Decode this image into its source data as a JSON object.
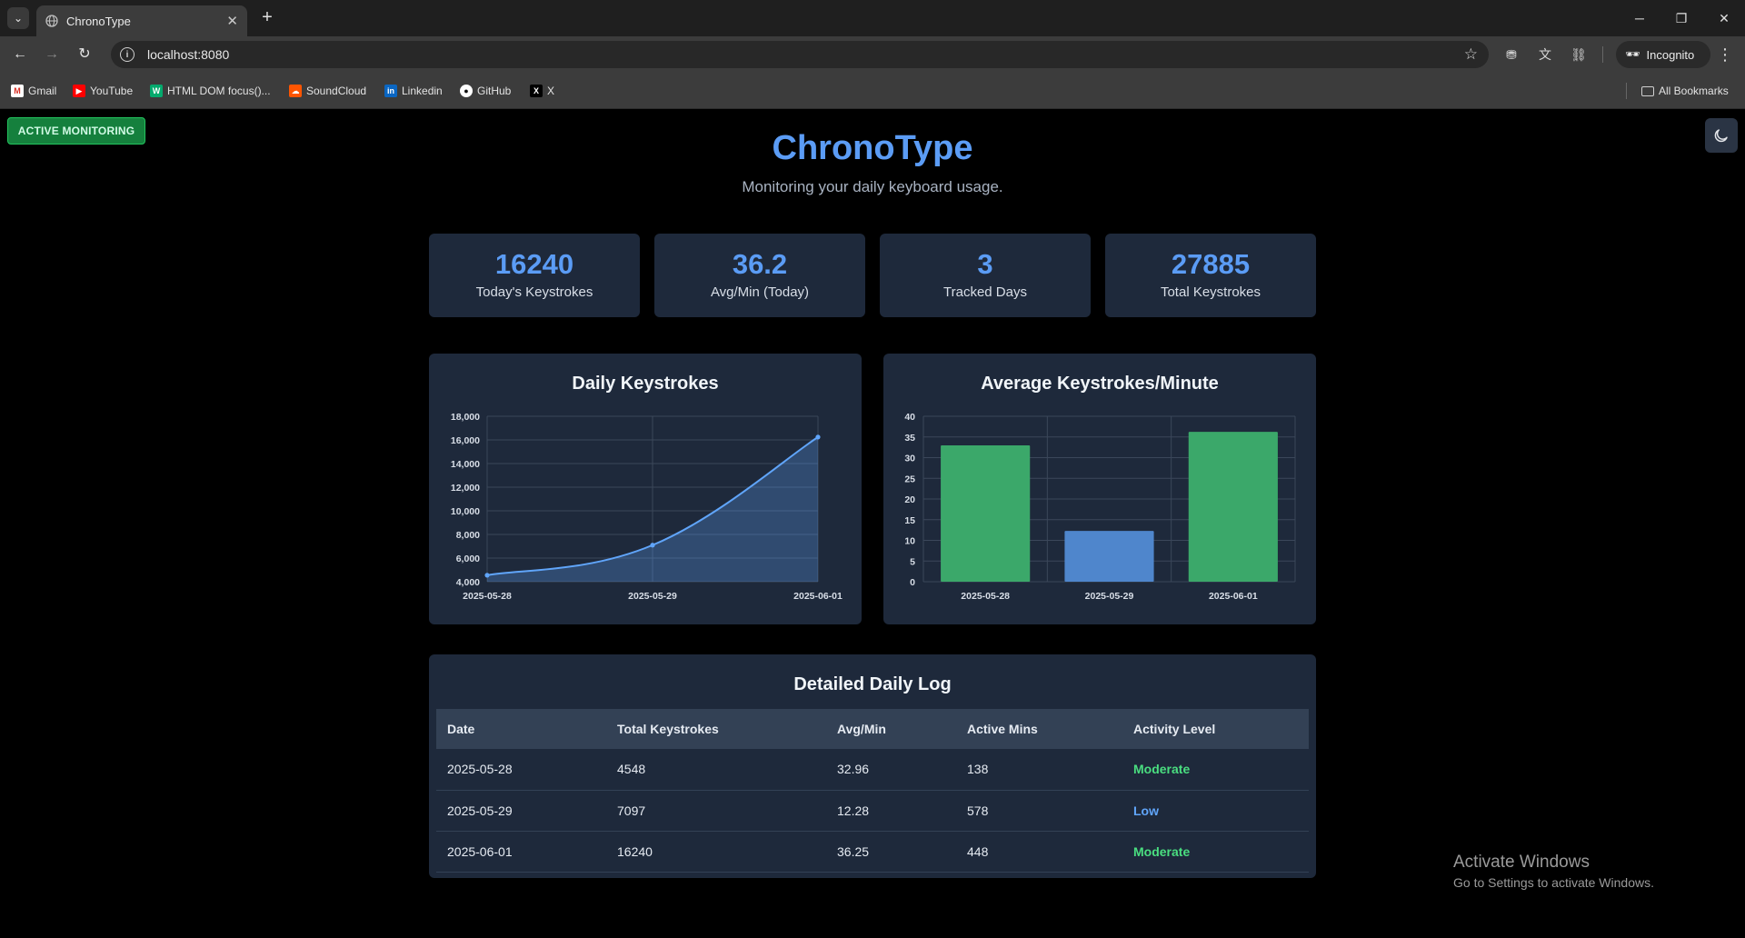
{
  "browser": {
    "tab_title": "ChronoType",
    "url": "localhost:8080",
    "incognito_label": "Incognito",
    "all_bookmarks_label": "All Bookmarks",
    "bookmarks": [
      {
        "label": "Gmail",
        "icon": "gmail-icon"
      },
      {
        "label": "YouTube",
        "icon": "youtube-icon"
      },
      {
        "label": "HTML DOM focus()...",
        "icon": "w3-icon"
      },
      {
        "label": "SoundCloud",
        "icon": "soundcloud-icon"
      },
      {
        "label": "Linkedin",
        "icon": "linkedin-icon"
      },
      {
        "label": "GitHub",
        "icon": "github-icon"
      },
      {
        "label": "X",
        "icon": "x-icon"
      }
    ]
  },
  "app": {
    "status_badge": "ACTIVE MONITORING",
    "title": "ChronoType",
    "subtitle": "Monitoring your daily keyboard usage.",
    "accent_color": "#5b9cf5"
  },
  "stats": [
    {
      "value": "16240",
      "label": "Today's Keystrokes"
    },
    {
      "value": "36.2",
      "label": "Avg/Min (Today)"
    },
    {
      "value": "3",
      "label": "Tracked Days"
    },
    {
      "value": "27885",
      "label": "Total Keystrokes"
    }
  ],
  "chart_data": [
    {
      "type": "area",
      "title": "Daily Keystrokes",
      "categories": [
        "2025-05-28",
        "2025-05-29",
        "2025-06-01"
      ],
      "series": [
        {
          "values": [
            4548,
            7097,
            16240
          ],
          "color": "#60a5fa"
        }
      ],
      "ylim": [
        4000,
        18000
      ],
      "yticks": [
        "4,000",
        "6,000",
        "8,000",
        "10,000",
        "12,000",
        "14,000",
        "16,000",
        "18,000"
      ],
      "grid": true
    },
    {
      "type": "bar",
      "title": "Average Keystrokes/Minute",
      "categories": [
        "2025-05-28",
        "2025-05-29",
        "2025-06-01"
      ],
      "values": [
        32.96,
        12.28,
        36.25
      ],
      "colors": [
        "#3ba86a",
        "#4f86cc",
        "#3ba86a"
      ],
      "ylim": [
        0,
        40
      ],
      "yticks": [
        "0",
        "5",
        "10",
        "15",
        "20",
        "25",
        "30",
        "35",
        "40"
      ],
      "grid": true
    }
  ],
  "log": {
    "title": "Detailed Daily Log",
    "columns": [
      "Date",
      "Total Keystrokes",
      "Avg/Min",
      "Active Mins",
      "Activity Level"
    ],
    "rows": [
      {
        "date": "2025-05-28",
        "total": "4548",
        "avg": "32.96",
        "mins": "138",
        "level": "Moderate",
        "level_color": "#4ade80"
      },
      {
        "date": "2025-05-29",
        "total": "7097",
        "avg": "12.28",
        "mins": "578",
        "level": "Low",
        "level_color": "#60a5fa"
      },
      {
        "date": "2025-06-01",
        "total": "16240",
        "avg": "36.25",
        "mins": "448",
        "level": "Moderate",
        "level_color": "#4ade80"
      }
    ]
  },
  "watermark": {
    "line1": "Activate Windows",
    "line2": "Go to Settings to activate Windows."
  }
}
